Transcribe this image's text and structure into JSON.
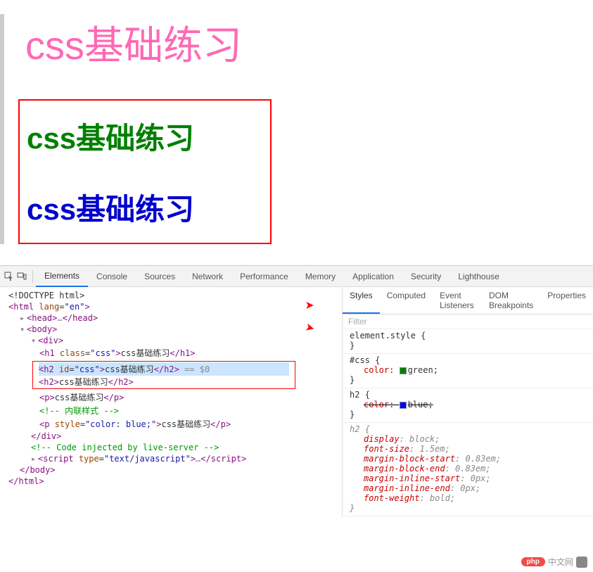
{
  "page": {
    "title": "css基础练习",
    "greenText": "css基础练习",
    "blueText": "css基础练习"
  },
  "tabs": {
    "elements": "Elements",
    "console": "Console",
    "sources": "Sources",
    "network": "Network",
    "performance": "Performance",
    "memory": "Memory",
    "application": "Application",
    "security": "Security",
    "lighthouse": "Lighthouse"
  },
  "tree": {
    "doctype": "<!DOCTYPE html>",
    "htmlOpen": "html",
    "htmlLang": "lang",
    "htmlLangVal": "en",
    "head": "head",
    "body": "body",
    "div": "div",
    "h1": "h1",
    "h1Class": "class",
    "h1ClassVal": "css",
    "h1Text": "css基础练习",
    "h2a": "h2",
    "h2aId": "id",
    "h2aIdVal": "css",
    "h2aText": "css基础练习",
    "eqDollar": " == $0",
    "h2b": "h2",
    "h2bText": "css基础练习",
    "p1": "p",
    "p1Text": "css基础练习",
    "comment1": "<!-- 内联样式 -->",
    "p2": "p",
    "p2Style": "style",
    "p2StyleVal": "color: blue;",
    "p2Text": "css基础练习",
    "comment2": "<!-- Code injected by live-server -->",
    "script": "script",
    "scriptType": "type",
    "scriptTypeVal": "text/javascript"
  },
  "stylesTabs": {
    "styles": "Styles",
    "computed": "Computed",
    "eventListeners": "Event Listeners",
    "domBreakpoints": "DOM Breakpoints",
    "properties": "Properties"
  },
  "filter": "Filter",
  "styleRules": {
    "elementStyle": "element.style",
    "cssId": "#css",
    "colorProp": "color",
    "greenVal": "green",
    "h2Sel": "h2",
    "blueVal": "blue",
    "displayProp": "display",
    "blockVal": "block",
    "fontSizeProp": "font-size",
    "fontSizeVal": "1.5em",
    "mbsProp": "margin-block-start",
    "mbsVal": "0.83em",
    "mbeProp": "margin-block-end",
    "mbeVal": "0.83em",
    "misProp": "margin-inline-start",
    "misVal": "0px",
    "mieProp": "margin-inline-end",
    "mieVal": "0px",
    "fwProp": "font-weight",
    "fwVal": "bold"
  },
  "watermark": {
    "badge": "php",
    "text": "中文网"
  }
}
